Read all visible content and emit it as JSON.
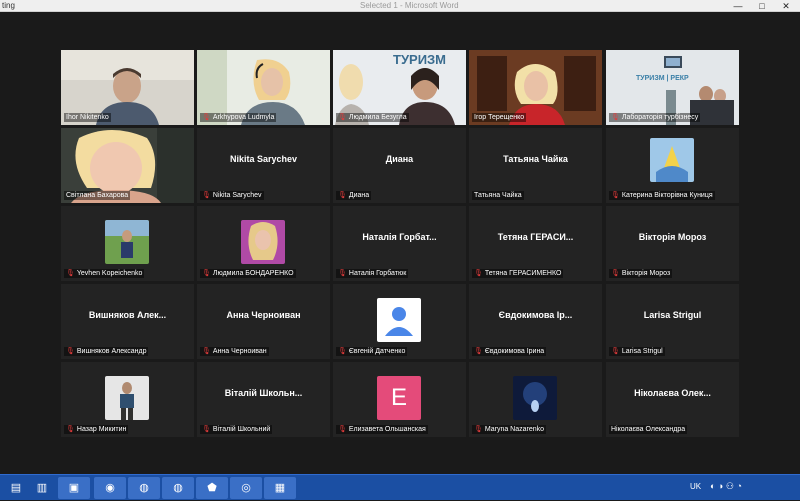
{
  "window": {
    "title": "ting",
    "center_title": "Selected 1 - Microsoft Word",
    "min_glyph": "—",
    "max_glyph": "□",
    "close_glyph": "✕"
  },
  "tiles": [
    {
      "label": "Ihor Nikitenko",
      "muted": false
    },
    {
      "label": "Arkhypova Ludmyla",
      "muted": true
    },
    {
      "label": "Людмила Безугла",
      "muted": true
    },
    {
      "label": "Ігор Терещенко",
      "muted": false
    },
    {
      "label": "Лабораторія турбізнесу",
      "muted": true
    },
    {
      "label": "Світлана Бахарова",
      "muted": false
    },
    {
      "label": "Nikita Sarychev",
      "muted": true,
      "center": "Nikita Sarychev"
    },
    {
      "label": "Диана",
      "muted": true,
      "center": "Диана"
    },
    {
      "label": "Татьяна Чайка",
      "muted": false,
      "center": "Татьяна Чайка"
    },
    {
      "label": "Катерина Вікторівна Куниця",
      "muted": true
    },
    {
      "label": "Yevhen Kopeichenko",
      "muted": true
    },
    {
      "label": "Людмила БОНДАРЕНКО",
      "muted": true
    },
    {
      "label": "Наталія Горбатюк",
      "muted": true,
      "center": "Наталія Горбат..."
    },
    {
      "label": "Тетяна ГЕРАСИМЕНКО",
      "muted": true,
      "center": "Тетяна ГЕРАСИ..."
    },
    {
      "label": "Вікторія Мороз",
      "muted": true,
      "center": "Вікторія Мороз"
    },
    {
      "label": "Вишняков Александр",
      "muted": true,
      "center": "Вишняков Алек..."
    },
    {
      "label": "Анна Черноиван",
      "muted": true,
      "center": "Анна Черноиван"
    },
    {
      "label": "Євгеній Датченко",
      "muted": true
    },
    {
      "label": "Євдокимова Ірина",
      "muted": true,
      "center": "Євдокимова Ір..."
    },
    {
      "label": "Larisa Strigul",
      "muted": true,
      "center": "Larisa Strigul"
    },
    {
      "label": "Назар Микитин",
      "muted": true
    },
    {
      "label": "Віталій Школьний",
      "muted": true,
      "center": "Віталій Школьн..."
    },
    {
      "label": "Елизавета Ольшанская",
      "muted": true,
      "avatar_letter": "E"
    },
    {
      "label": "Maryna Nazarenko",
      "muted": true
    },
    {
      "label": "Ніколаєва Олександра",
      "muted": false,
      "center": "Ніколаєва Олек..."
    }
  ],
  "taskbar": {
    "tray_language": "UK",
    "app_icons": [
      "file-explorer-icon",
      "notepad-icon",
      "save-disk-icon",
      "edge-icon",
      "chrome-icon",
      "chrome-icon",
      "acrobat-icon",
      "zoom-icon",
      "word-icon"
    ]
  },
  "colors": {
    "active_speaker_border": "#c7d63a",
    "tile_bg": "#232323",
    "muted_mic": "#e23b3b",
    "taskbar": "#1b4fa3",
    "avatar_e_bg": "#e44b7a"
  }
}
